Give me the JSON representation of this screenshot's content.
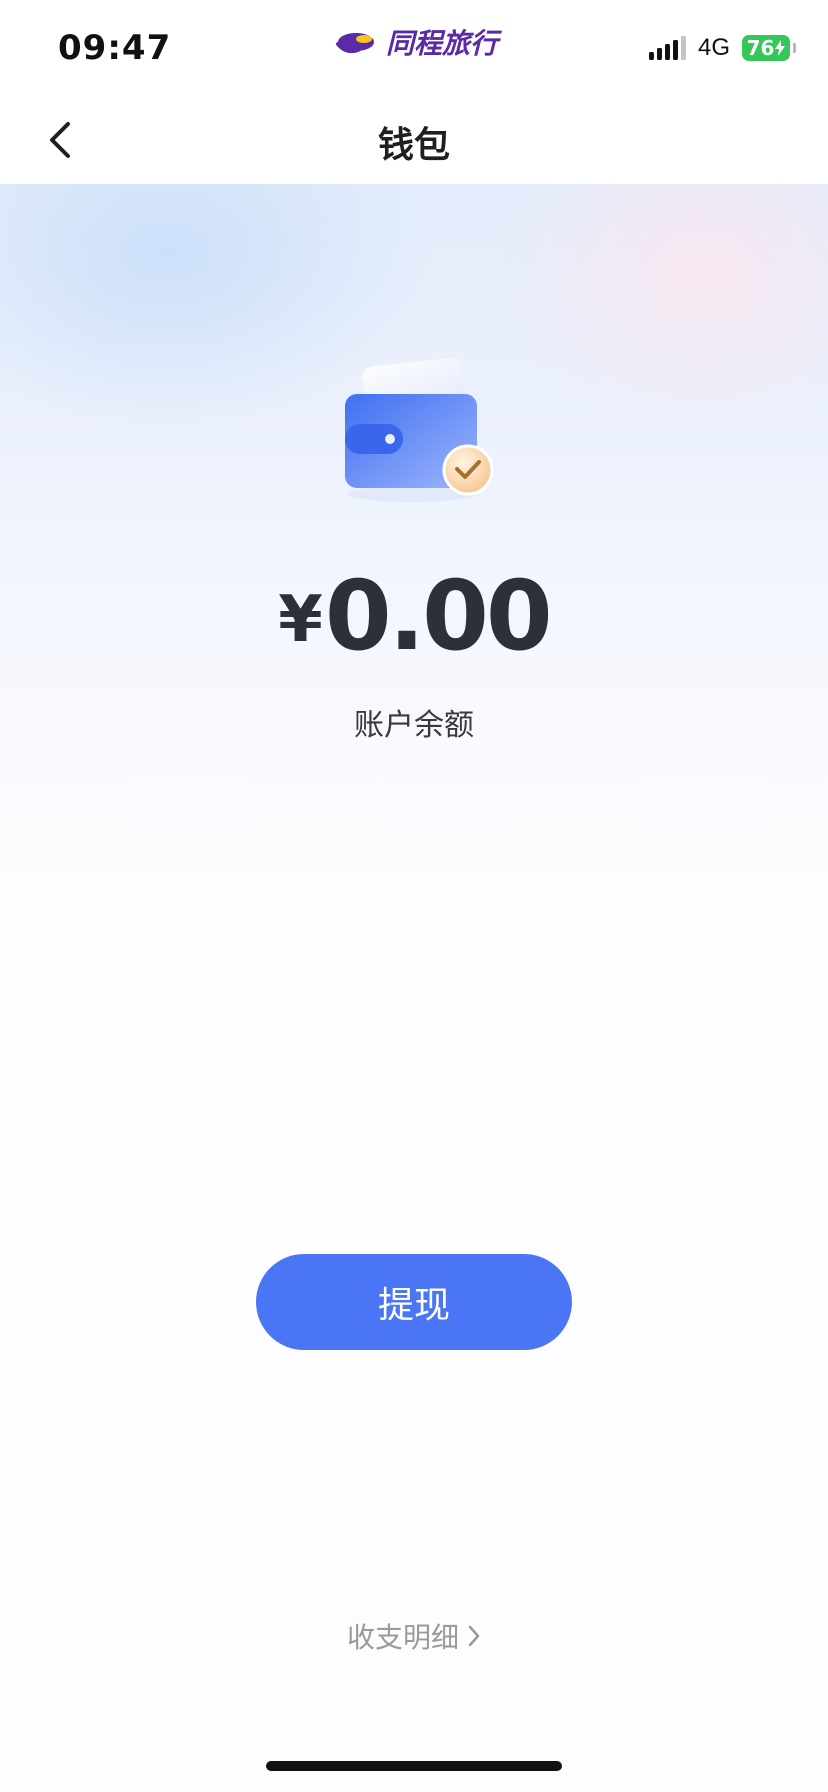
{
  "status_bar": {
    "time": "09:47",
    "brand": "同程旅行",
    "network": "4G",
    "battery": "76"
  },
  "nav": {
    "title": "钱包"
  },
  "wallet": {
    "currency_symbol": "¥",
    "balance": "0.00",
    "balance_label": "账户余额"
  },
  "actions": {
    "withdraw_label": "提现",
    "details_label": "收支明细"
  },
  "colors": {
    "primary": "#4a76f5",
    "battery": "#34c759",
    "brand": "#5b2aa6"
  },
  "icons": {
    "back": "chevron-left-icon",
    "details": "chevron-right-icon",
    "wallet": "wallet-icon"
  }
}
